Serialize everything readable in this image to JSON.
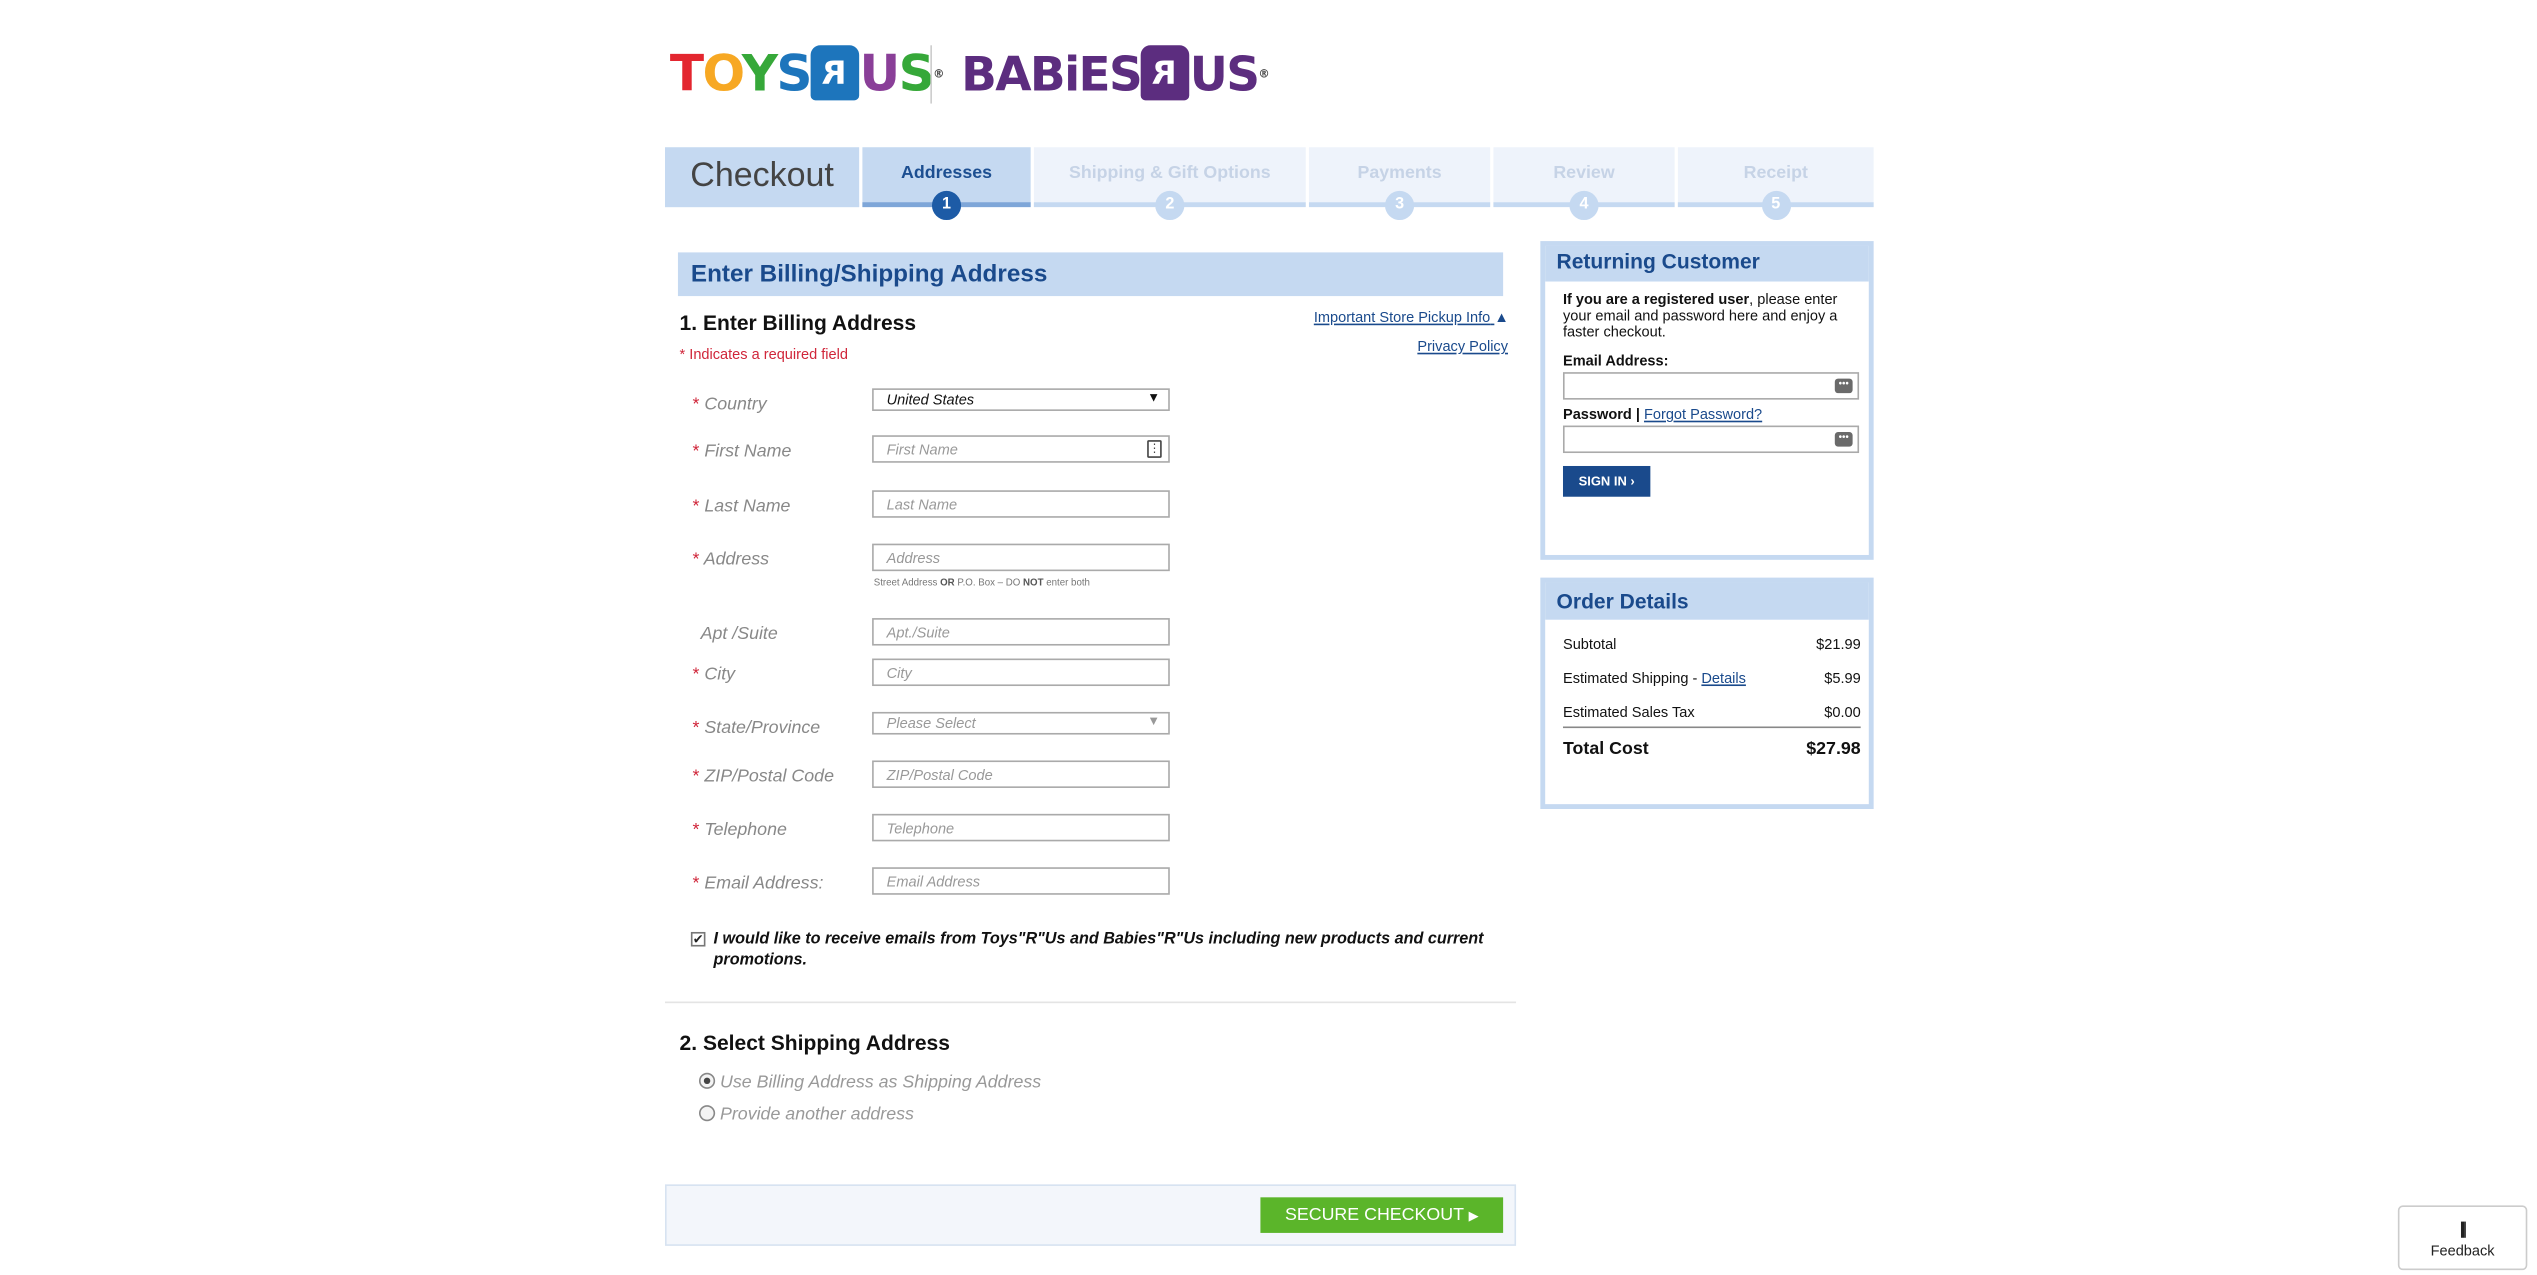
{
  "brand": {
    "toysrus": "TOYS R US",
    "babiesrus": "BABIES R US"
  },
  "steps": {
    "title": "Checkout",
    "items": [
      {
        "label": "Addresses",
        "num": "1"
      },
      {
        "label": "Shipping & Gift Options",
        "num": "2"
      },
      {
        "label": "Payments",
        "num": "3"
      },
      {
        "label": "Review",
        "num": "4"
      },
      {
        "label": "Receipt",
        "num": "5"
      }
    ]
  },
  "billing": {
    "section_title": "Enter Billing/Shipping Address",
    "heading": "1. Enter Billing Address",
    "required_note": "* Indicates a required field",
    "store_pickup_link": "Important Store Pickup Info",
    "privacy_link": "Privacy Policy",
    "fields": {
      "country_label": "Country",
      "country_value": "United States",
      "first_name_label": "First Name",
      "first_name_placeholder": "First Name",
      "last_name_label": "Last Name",
      "last_name_placeholder": "Last Name",
      "address_label": "Address",
      "address_placeholder": "Address",
      "address_hint_a": "Street Address ",
      "address_hint_or": "OR",
      "address_hint_b": " P.O. Box – DO ",
      "address_hint_not": "NOT",
      "address_hint_c": " enter both",
      "apt_label": "Apt /Suite",
      "apt_placeholder": "Apt./Suite",
      "city_label": "City",
      "city_placeholder": "City",
      "state_label": "State/Province",
      "state_value": "Please Select",
      "zip_label": "ZIP/Postal Code",
      "zip_placeholder": "ZIP/Postal Code",
      "phone_label": "Telephone",
      "phone_placeholder": "Telephone",
      "email_label": "Email Address:",
      "email_placeholder": "Email Address"
    },
    "optin_text": "I would like to receive emails from Toys\"R\"Us and Babies\"R\"Us including new products and current promotions.",
    "optin_checked": true
  },
  "shipping": {
    "heading": "2. Select Shipping Address",
    "options": [
      {
        "label": "Use Billing Address as Shipping Address",
        "selected": true
      },
      {
        "label": "Provide another address",
        "selected": false
      }
    ],
    "checkout_button": "SECURE CHECKOUT"
  },
  "returning": {
    "title": "Returning Customer",
    "intro_bold": "If you are a registered user",
    "intro_rest": ", please enter your email and password here and enjoy a faster checkout.",
    "email_label": "Email Address:",
    "password_label": "Password |",
    "forgot_link": "Forgot Password?",
    "sign_in": "SIGN IN"
  },
  "order": {
    "title": "Order Details",
    "subtotal_label": "Subtotal",
    "subtotal": "$21.99",
    "shipping_label": "Estimated Shipping - ",
    "shipping_link": "Details",
    "shipping": "$5.99",
    "tax_label": "Estimated Sales Tax",
    "tax": "$0.00",
    "total_label": "Total Cost",
    "total": "$27.98"
  },
  "feedback": "Feedback",
  "colors": {
    "accent_blue": "#1a4a8c",
    "panel_blue": "#c5d9f1",
    "required_red": "#d0263a",
    "checkout_green": "#5bb52a"
  }
}
